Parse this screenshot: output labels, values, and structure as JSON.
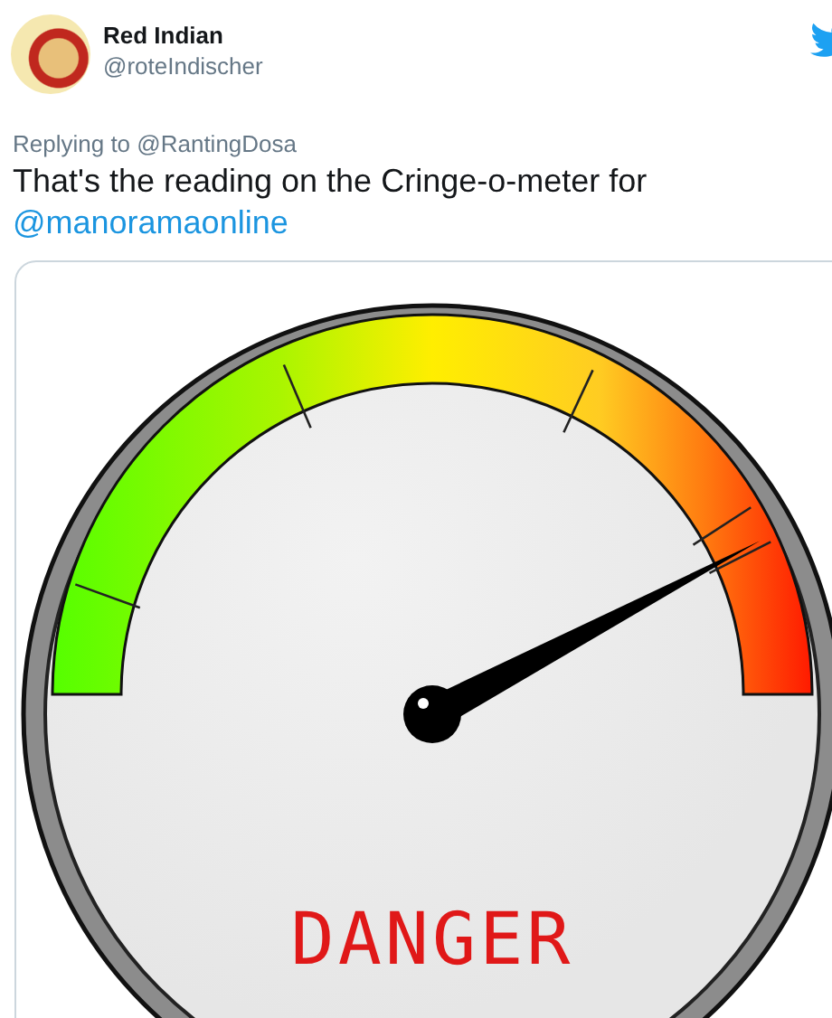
{
  "author": {
    "name": "Red Indian",
    "handle": "@roteIndischer"
  },
  "reply": {
    "text": "Replying to @RantingDosa"
  },
  "tweet": {
    "text": "That's the reading on the Cringe-o-meter for",
    "mention": "@manoramaonline"
  },
  "media": {
    "gauge": {
      "label": "DANGER"
    }
  }
}
